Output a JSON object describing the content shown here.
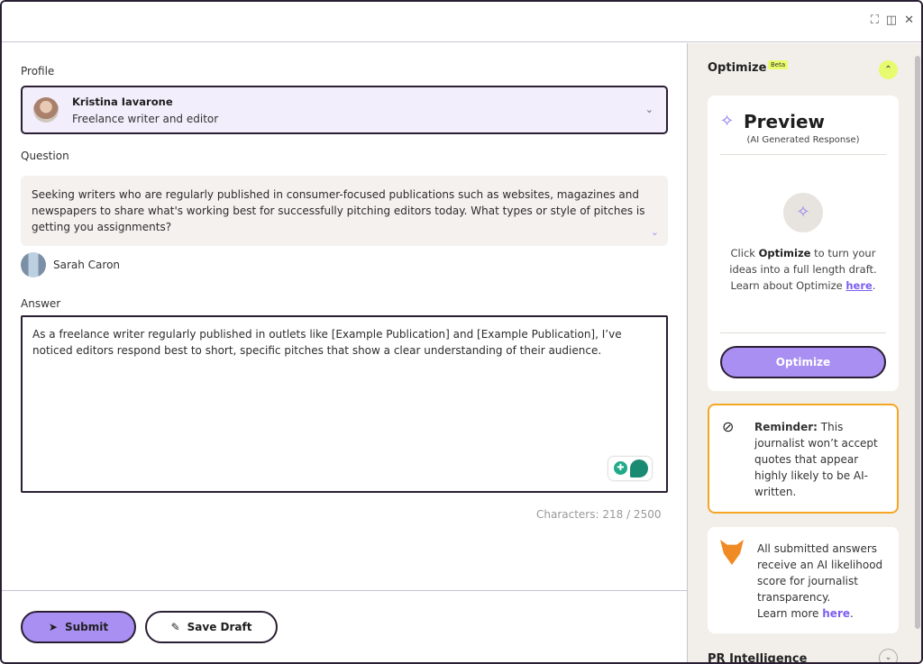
{
  "window": {
    "controls": [
      "expand-icon",
      "split-view-icon",
      "close-icon"
    ]
  },
  "form": {
    "profile_label": "Profile",
    "profile": {
      "name": "Kristina Iavarone",
      "role": "Freelance writer and editor"
    },
    "question_label": "Question",
    "question_text": "Seeking writers who are regularly published in consumer-focused publications such as websites, magazines and newspapers to share what's working best for successfully pitching editors today. What types or style of pitches is getting you assignments?",
    "asker_name": "Sarah Caron",
    "answer_label": "Answer",
    "answer_text": "As a freelance writer regularly published in outlets like [Example Publication] and [Example Publication], I’ve noticed editors respond best to short, specific pitches that show a clear understanding of their audience.",
    "char_count": "Characters: 218 / 2500",
    "submit_label": "Submit",
    "save_draft_label": "Save Draft"
  },
  "sidebar": {
    "title": "Optimize",
    "badge": "Beta",
    "preview": {
      "title": "Preview",
      "subtitle": "(AI Generated Response)",
      "text_before": "Click ",
      "text_bold": "Optimize",
      "text_after": " to turn your ideas into a full length draft. Learn about Optimize ",
      "link": "here",
      "text_end": ".",
      "button": "Optimize"
    },
    "reminder": {
      "bold": "Reminder:",
      "text": " This journalist won’t accept quotes that appear highly likely to be AI-written."
    },
    "ai_notice": {
      "text": "All submitted answers receive an AI likelihood score for journalist transparency.",
      "learn_more": "Learn more ",
      "link": "here",
      "end": "."
    },
    "pr_section": "PR Intelligence"
  },
  "colors": {
    "accent": "#a98ff2",
    "border": "#2a1e33",
    "highlight": "#e6fb6e",
    "reminder_border": "#f5a623"
  }
}
